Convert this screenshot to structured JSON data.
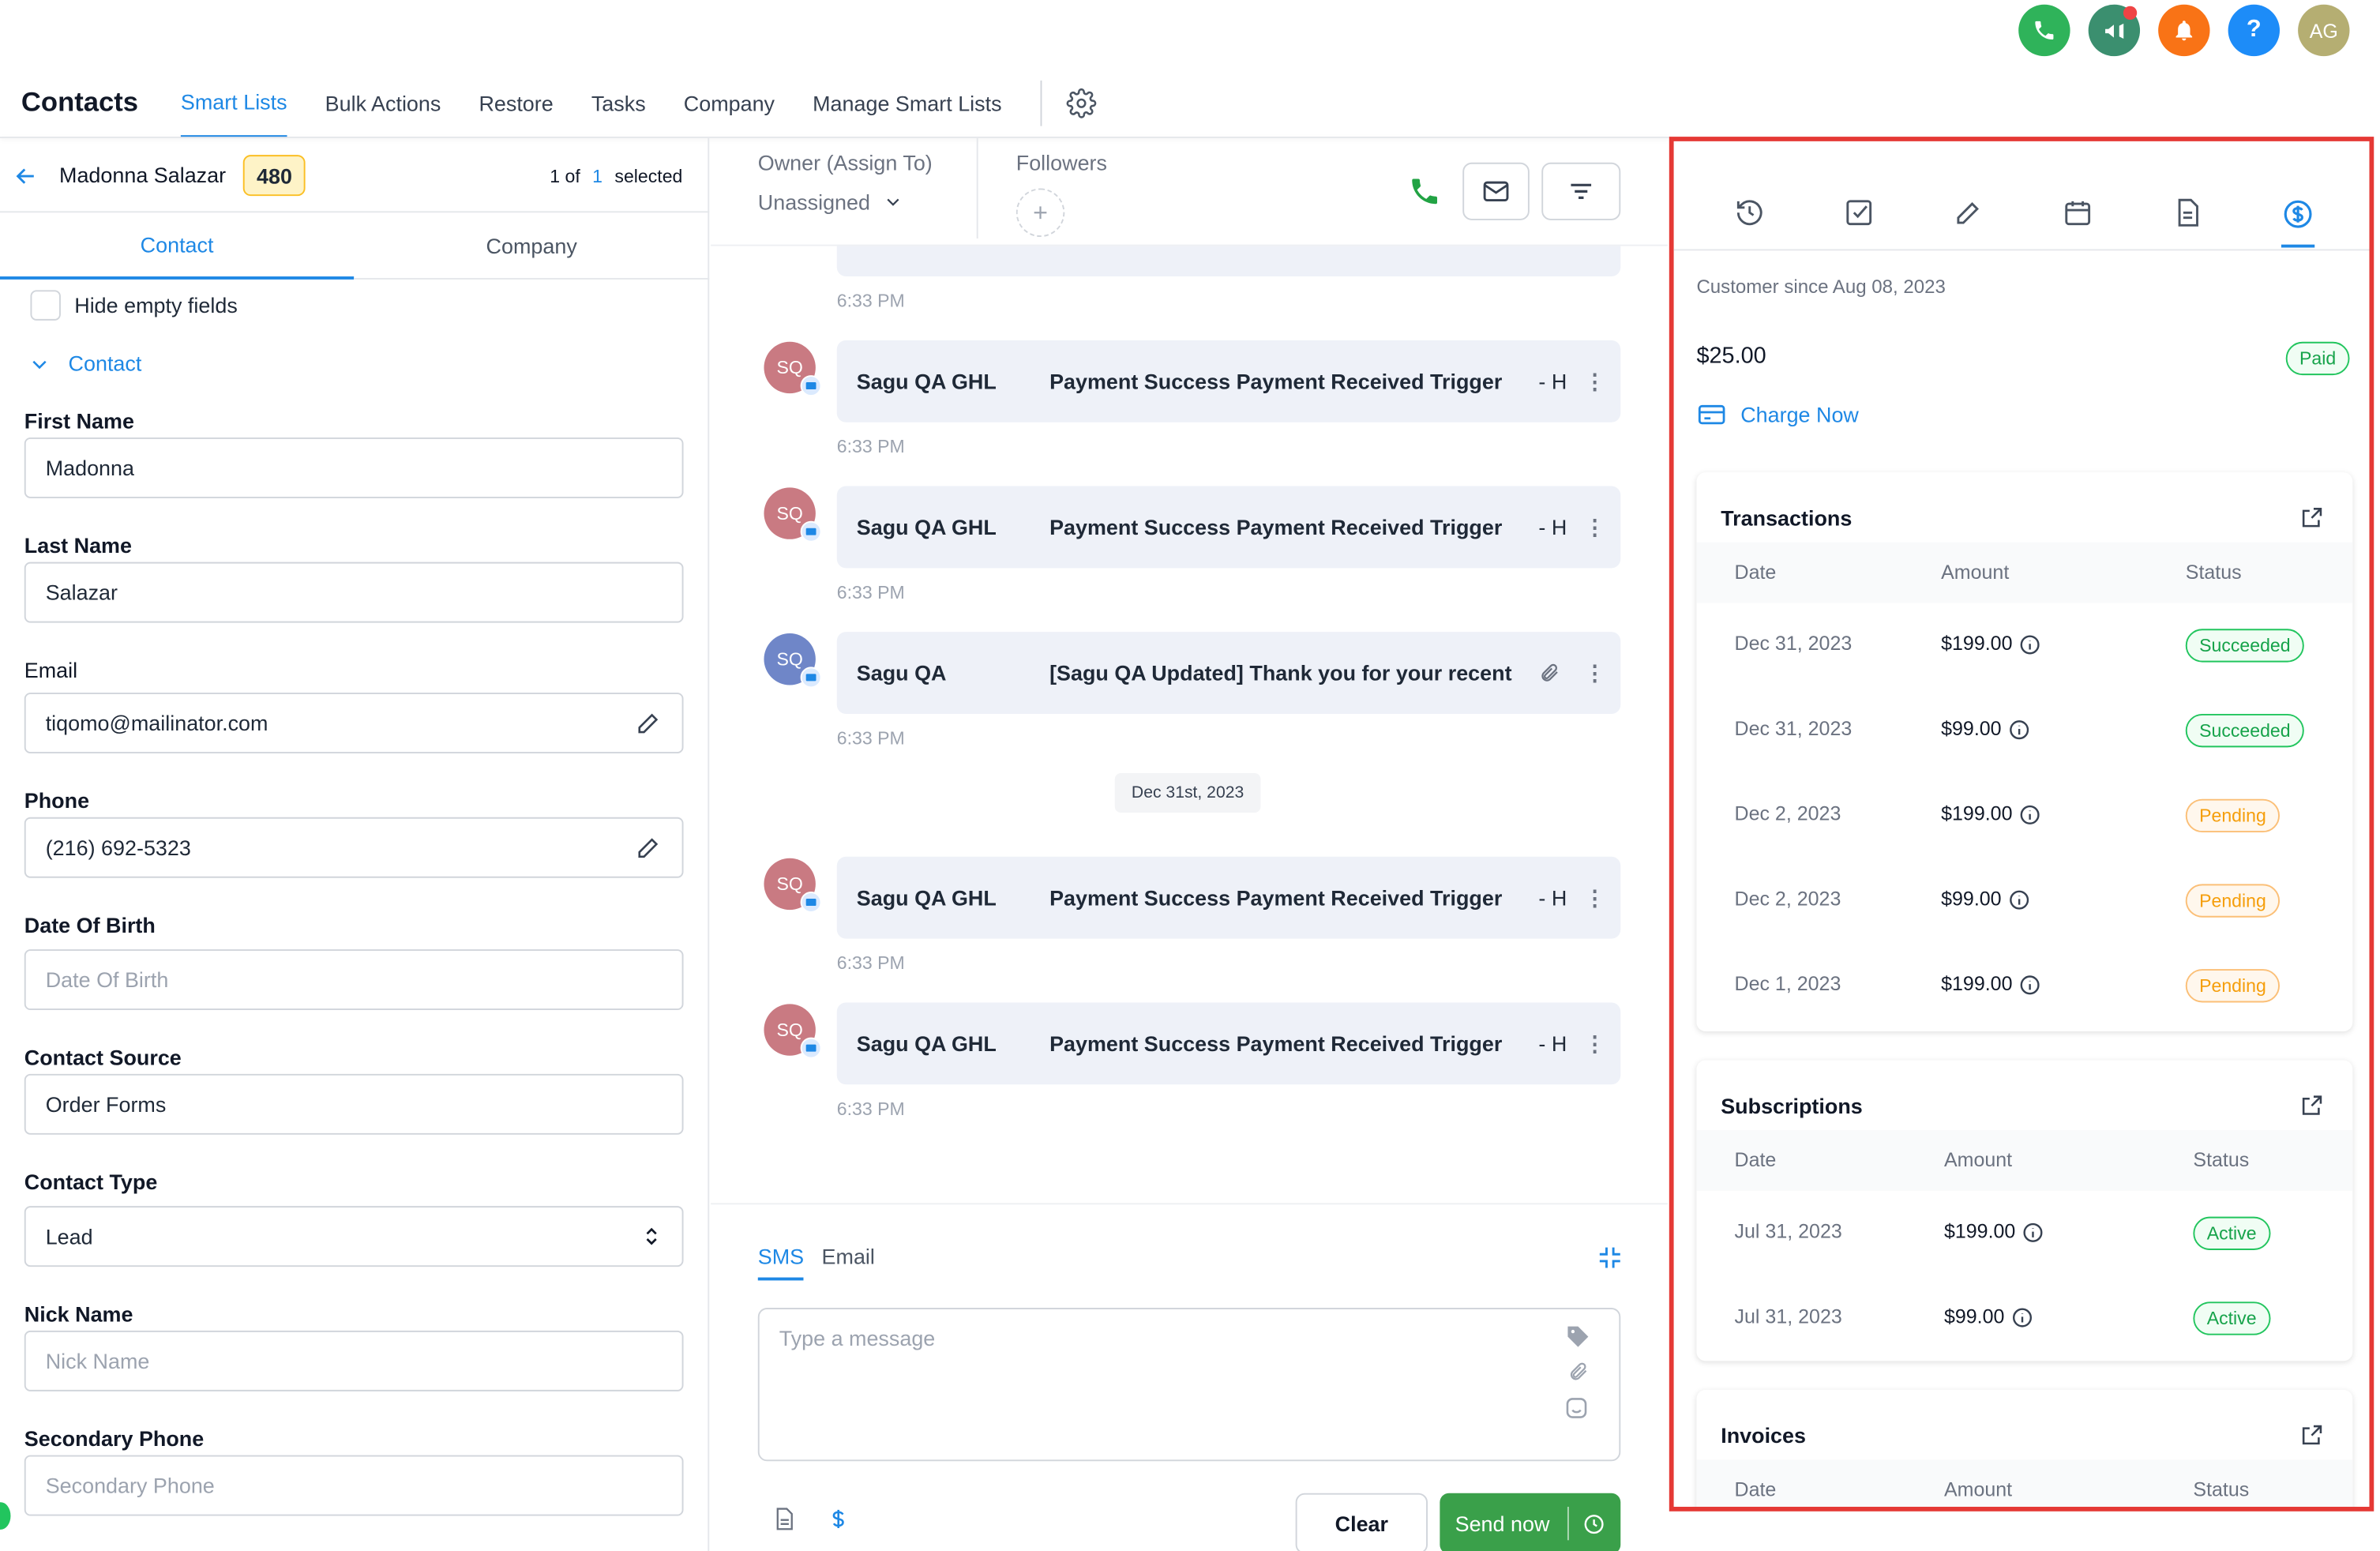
{
  "header": {
    "title": "Contacts",
    "tabs": [
      {
        "label": "Smart Lists"
      },
      {
        "label": "Bulk Actions"
      },
      {
        "label": "Restore"
      },
      {
        "label": "Tasks"
      },
      {
        "label": "Company"
      },
      {
        "label": "Manage Smart Lists"
      }
    ],
    "avatar_initials": "AG",
    "help_label": "?",
    "colors": {
      "phone": "#2fb35a",
      "megaphone": "#3b8f6f",
      "bell": "#f97316",
      "help": "#1d8cf8",
      "avatar": "#b5ae72"
    }
  },
  "contact_bar": {
    "name": "Madonna Salazar",
    "count": "480",
    "of_label": "1 of",
    "of_total": "1",
    "selected": "selected"
  },
  "left_tabs": [
    {
      "label": "Contact"
    },
    {
      "label": "Company"
    }
  ],
  "hide_empty": "Hide empty fields",
  "section": "Contact",
  "fields": [
    {
      "label": "First Name",
      "value": "Madonna",
      "placeholder": ""
    },
    {
      "label": "Last Name",
      "value": "Salazar",
      "placeholder": ""
    },
    {
      "label": "Email",
      "value": "tiqomo@mailinator.com",
      "placeholder": ""
    },
    {
      "label": "Phone",
      "value": "(216) 692-5323",
      "placeholder": ""
    },
    {
      "label": "Date Of Birth",
      "value": "",
      "placeholder": "Date Of Birth"
    },
    {
      "label": "Contact Source",
      "value": "Order Forms",
      "placeholder": ""
    },
    {
      "label": "Contact Type",
      "value": "Lead",
      "placeholder": ""
    },
    {
      "label": "Nick Name",
      "value": "",
      "placeholder": "Nick Name"
    },
    {
      "label": "Secondary Phone",
      "value": "",
      "placeholder": "Secondary Phone"
    }
  ],
  "conversation": {
    "owner_label": "Owner (Assign To)",
    "owner_value": "Unassigned",
    "followers_label": "Followers",
    "date_divider": "Dec 31st, 2023",
    "first_time": "6:33 PM",
    "messages": [
      {
        "initials": "SQ",
        "sender": "Sagu QA GHL",
        "subject": "Payment Success Payment Received Trigger",
        "tail": "-  H",
        "time": "6:33 PM",
        "avatar_color": "#c97a82"
      },
      {
        "initials": "SQ",
        "sender": "Sagu QA GHL",
        "subject": "Payment Success Payment Received Trigger",
        "tail": "-  H",
        "time": "6:33 PM",
        "avatar_color": "#c97a82"
      },
      {
        "initials": "SQ",
        "sender": "Sagu QA",
        "subject": "[Sagu QA Updated] Thank you for your recent",
        "tail": "",
        "time": "6:33 PM",
        "avatar_color": "#6f86c8"
      },
      {
        "initials": "SQ",
        "sender": "Sagu QA GHL",
        "subject": "Payment Success Payment Received Trigger",
        "tail": "-  H",
        "time": "6:33 PM",
        "avatar_color": "#c97a82"
      },
      {
        "initials": "SQ",
        "sender": "Sagu QA GHL",
        "subject": "Payment Success Payment Received Trigger",
        "tail": "-  H",
        "time": "6:33 PM",
        "avatar_color": "#c97a82"
      }
    ],
    "composer": {
      "tab_sms": "SMS",
      "tab_email": "Email",
      "placeholder": "Type a message",
      "clear": "Clear",
      "send": "Send now"
    }
  },
  "payments": {
    "customer_since": "Customer since Aug 08, 2023",
    "amount": "$25.00",
    "paid_badge": "Paid",
    "charge_now": "Charge Now",
    "transactions": {
      "title": "Transactions",
      "columns": [
        "Date",
        "Amount",
        "Status"
      ],
      "rows": [
        {
          "date": "Dec 31, 2023",
          "amount": "$199.00",
          "status": "Succeeded",
          "kind": "green"
        },
        {
          "date": "Dec 31, 2023",
          "amount": "$99.00",
          "status": "Succeeded",
          "kind": "green"
        },
        {
          "date": "Dec 2, 2023",
          "amount": "$199.00",
          "status": "Pending",
          "kind": "orange"
        },
        {
          "date": "Dec 2, 2023",
          "amount": "$99.00",
          "status": "Pending",
          "kind": "orange"
        },
        {
          "date": "Dec 1, 2023",
          "amount": "$199.00",
          "status": "Pending",
          "kind": "orange"
        }
      ]
    },
    "subscriptions": {
      "title": "Subscriptions",
      "columns": [
        "Date",
        "Amount",
        "Status"
      ],
      "rows": [
        {
          "date": "Jul 31, 2023",
          "amount": "$199.00",
          "status": "Active",
          "kind": "green"
        },
        {
          "date": "Jul 31, 2023",
          "amount": "$99.00",
          "status": "Active",
          "kind": "green"
        }
      ]
    },
    "invoices": {
      "title": "Invoices",
      "columns": [
        "Date",
        "Amount",
        "Status"
      ]
    }
  }
}
